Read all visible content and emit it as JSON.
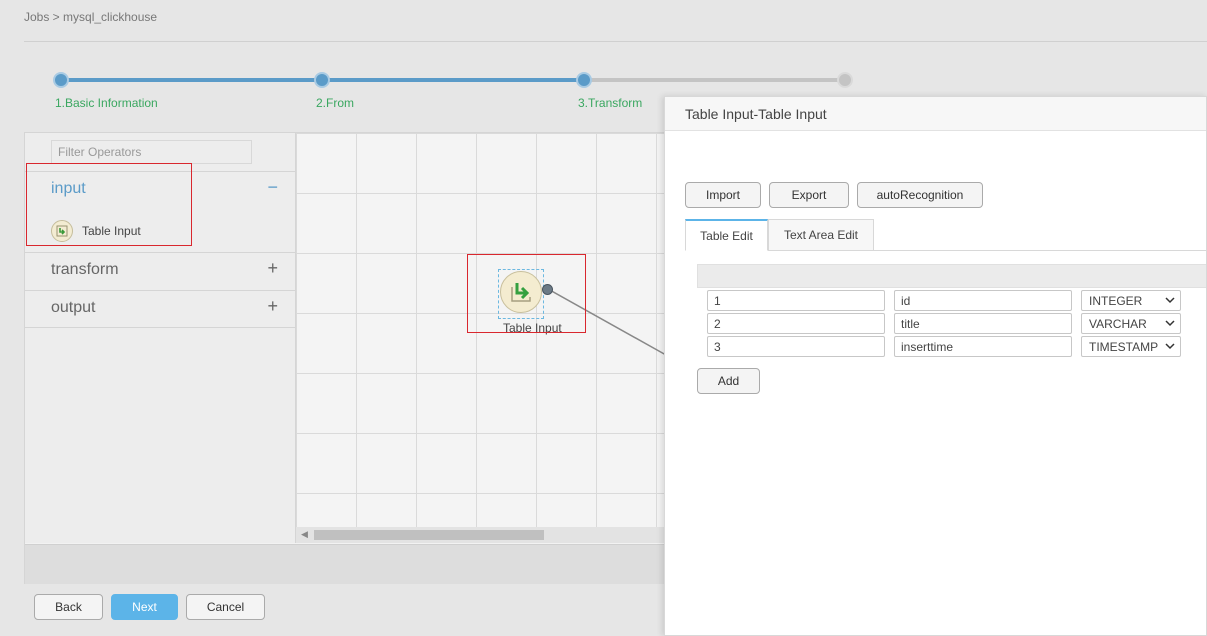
{
  "breadcrumb": "Jobs > mysql_clickhouse",
  "steps": [
    {
      "label": "1.Basic Information",
      "status": "done"
    },
    {
      "label": "2.From",
      "status": "done"
    },
    {
      "label": "3.Transform",
      "status": "current"
    },
    {
      "label": "",
      "status": "todo"
    }
  ],
  "operators": {
    "filter_placeholder": "Filter Operators",
    "groups": [
      {
        "name": "input",
        "toggle": "−",
        "expanded": true,
        "items": [
          {
            "label": "Table Input",
            "icon": "table-input-icon"
          }
        ]
      },
      {
        "name": "transform",
        "toggle": "+",
        "expanded": false
      },
      {
        "name": "output",
        "toggle": "+",
        "expanded": false
      }
    ]
  },
  "canvas": {
    "node": {
      "label": "Table Input",
      "icon": "table-input-icon"
    }
  },
  "footer": {
    "back": "Back",
    "next": "Next",
    "cancel": "Cancel"
  },
  "dialog": {
    "title": "Table Input-Table Input",
    "buttons": {
      "import": "Import",
      "export": "Export",
      "auto": "autoRecognition"
    },
    "tabs": [
      {
        "label": "Table Edit",
        "active": true
      },
      {
        "label": "Text Area Edit",
        "active": false
      }
    ],
    "rows": [
      {
        "index": "1",
        "name": "id",
        "type": "INTEGER"
      },
      {
        "index": "2",
        "name": "title",
        "type": "VARCHAR"
      },
      {
        "index": "3",
        "name": "inserttime",
        "type": "TIMESTAMP"
      }
    ],
    "add_label": "Add"
  },
  "colors": {
    "accent": "#5cb4e8",
    "step_done": "#5b9bc8",
    "step_text": "#3aa760",
    "highlight": "#d9272e"
  }
}
